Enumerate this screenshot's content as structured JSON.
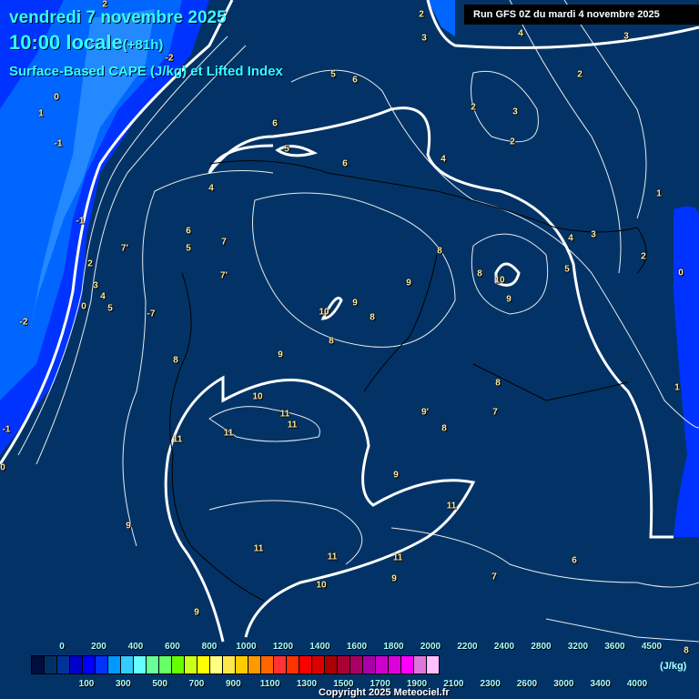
{
  "header": {
    "date": "vendredi 7 novembre 2025",
    "time": "10:00 locale",
    "lead": "(+81h)",
    "parameter": "Surface-Based CAPE (J/kg) et Lifted Index",
    "run": "Run GFS 0Z du mardi 4 novembre 2025"
  },
  "contour_labels": [
    "2",
    "2",
    "3",
    "4",
    "3",
    "-2",
    "0",
    "5",
    "6",
    "2",
    "1",
    "2",
    "3",
    "2",
    "6",
    "-1",
    "5",
    "6",
    "4",
    "4",
    "1",
    "-1",
    "6",
    "4",
    "3",
    "5",
    "7",
    "7'",
    "8",
    "2",
    "2",
    "7'",
    "8",
    "5",
    "0",
    "9",
    "10",
    "3",
    "4",
    "5",
    "0",
    "9",
    "10",
    "9",
    "8",
    "-7",
    "-2",
    "8",
    "9",
    "8",
    "8",
    "10",
    "7",
    "1",
    "11",
    "11",
    "9'",
    "8",
    "11",
    "11",
    "-1",
    "0",
    "9",
    "11",
    "9",
    "11",
    "11",
    "11",
    "6",
    "7",
    "9",
    "10",
    "9",
    "8"
  ],
  "legend": {
    "unit": "(J/kg)",
    "top_labels": [
      "0",
      "200",
      "400",
      "600",
      "800",
      "1000",
      "1200",
      "1400",
      "1600",
      "1800",
      "2000",
      "2200",
      "2400",
      "2800",
      "3200",
      "3600",
      "4500"
    ],
    "bottom_labels": [
      "100",
      "300",
      "500",
      "700",
      "900",
      "1100",
      "1300",
      "1500",
      "1700",
      "1900",
      "2100",
      "2300",
      "2600",
      "3000",
      "3400",
      "4000"
    ],
    "colors": [
      "#000e3e",
      "#003166",
      "#003399",
      "#0000cc",
      "#0000ff",
      "#0033ff",
      "#0099ff",
      "#33ccff",
      "#66ffff",
      "#66ff99",
      "#66ff66",
      "#66ff00",
      "#ccff19",
      "#ffff00",
      "#ffff80",
      "#ffe64d",
      "#ffcc00",
      "#ff9900",
      "#ff6600",
      "#ff3333",
      "#ff3300",
      "#ff0000",
      "#dd0000",
      "#aa0000",
      "#aa0033",
      "#aa0066",
      "#aa00aa",
      "#cc00cc",
      "#dd00dd",
      "#ff00ff",
      "#dd77dd",
      "#ffc0ff",
      "#ffffff"
    ]
  },
  "copyright": "Copyright 2025 Meteociel.fr"
}
